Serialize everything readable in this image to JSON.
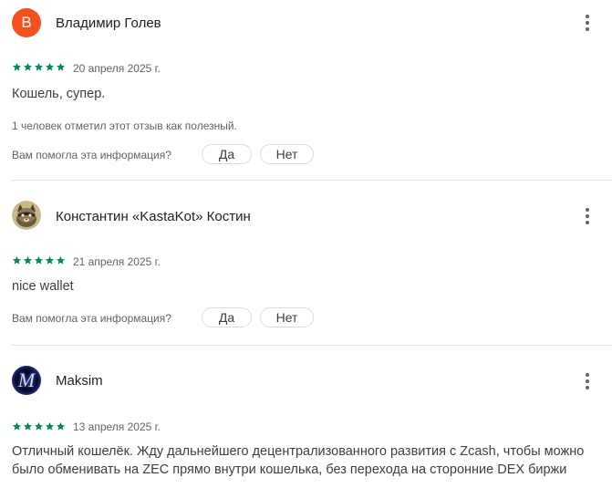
{
  "colors": {
    "star": "#01875f",
    "avatar_letter_bg": "#f4511e"
  },
  "reviews": [
    {
      "author": "Владимир Голев",
      "avatar_letter": "В",
      "rating": 5,
      "date": "20 апреля 2025 г.",
      "text": "Кошель, супер.",
      "helpful_count": "1 человек отметил этот отзыв как полезный.",
      "question": "Вам помогла эта информация?",
      "yes": "Да",
      "no": "Нет"
    },
    {
      "author": "Константин «KastaKot» Костин",
      "avatar_icon": "raccoon-avatar-icon",
      "rating": 5,
      "date": "21 апреля 2025 г.",
      "text": "nice wallet",
      "question": "Вам помогла эта информация?",
      "yes": "Да",
      "no": "Нет"
    },
    {
      "author": "Maksim",
      "avatar_letter": "M",
      "rating": 5,
      "date": "13 апреля 2025 г.",
      "text": "Отличный кошелёк. Жду дальнейшего децентрализованного развития с Zcash, чтобы можно было обменивать на ZEC прямо внутри кошелька, без перехода на сторонние DEX биржи"
    }
  ]
}
